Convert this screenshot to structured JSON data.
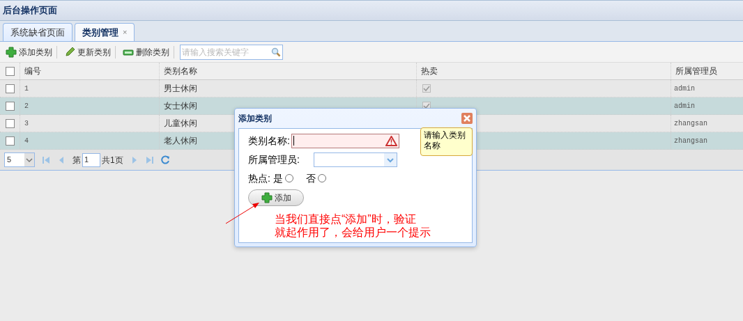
{
  "header": {
    "title": "后台操作页面"
  },
  "tabs": [
    {
      "label": "系统缺省页面",
      "selected": false,
      "closable": false
    },
    {
      "label": "类别管理",
      "selected": true,
      "closable": true,
      "close": "×"
    }
  ],
  "toolbar": {
    "buttons": [
      {
        "label": "添加类别",
        "kind": "add"
      },
      {
        "label": "更新类别",
        "kind": "edit"
      },
      {
        "label": "删除类别",
        "kind": "remove"
      }
    ],
    "search": {
      "placeholder": "请输入搜索关键字"
    }
  },
  "table": {
    "all_checked": false,
    "columns": [
      "编号",
      "类别名称",
      "热卖",
      "所属管理员"
    ],
    "rows": [
      {
        "id": "1",
        "name": "男士休闲",
        "hot": true,
        "admin": "admin",
        "checked": false
      },
      {
        "id": "2",
        "name": "女士休闲",
        "hot": true,
        "admin": "admin",
        "checked": false
      },
      {
        "id": "3",
        "name": "儿童休闲",
        "admin": "zhangsan",
        "checked": false
      },
      {
        "id": "4",
        "name": "老人休闲",
        "admin": "zhangsan",
        "checked": false
      }
    ]
  },
  "pager": {
    "page_size": "5",
    "page_prefix": "第",
    "page": "1",
    "page_total": "共1页"
  },
  "dialog": {
    "title": "添加类别",
    "name_label": "类别名称:",
    "name_invalid": true,
    "tooltip": "请输入类别名称",
    "admin_label": "所属管理员:",
    "hot_label": "热点:",
    "hot_options": [
      {
        "label": "是",
        "selected": false
      },
      {
        "label": "否",
        "selected": false
      }
    ],
    "submit": "添加"
  },
  "annotation": {
    "lines": [
      "当我们直接点“添加”时，验证",
      "就起作用了，会给用户一个提示"
    ]
  }
}
